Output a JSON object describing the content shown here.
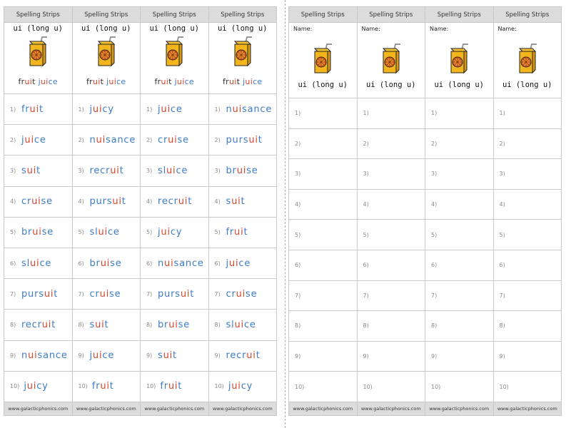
{
  "header_label": "Spelling Strips",
  "footer_label": "www.galacticphonics.com",
  "rule_label": "ui (long u)",
  "caption_parts": [
    {
      "text": "fr",
      "color": ""
    },
    {
      "text": "ui",
      "color": "#d8452b"
    },
    {
      "text": "t ",
      "color": ""
    },
    {
      "text": "j",
      "color": "#3d7cc9"
    },
    {
      "text": "ui",
      "color": "#d8452b"
    },
    {
      "text": "ce",
      "color": "#3d7cc9"
    }
  ],
  "name_label": "Name:",
  "icon": "juice-box-icon",
  "colors": {
    "header_bg": "#dcdcdc",
    "grapheme_red": "#d8452b",
    "word_blue": "#3d7cc9"
  },
  "numbers": [
    "1)",
    "2)",
    "3)",
    "4)",
    "5)",
    "6)",
    "7)",
    "8)",
    "9)",
    "10)"
  ],
  "strips": [
    {
      "words": [
        "fruit",
        "juice",
        "suit",
        "cruise",
        "bruise",
        "sluice",
        "pursuit",
        "recruit",
        "nuisance",
        "juicy"
      ]
    },
    {
      "words": [
        "juicy",
        "nuisance",
        "recruit",
        "pursuit",
        "sluice",
        "bruise",
        "cruise",
        "suit",
        "juice",
        "fruit"
      ]
    },
    {
      "words": [
        "juice",
        "cruise",
        "sluice",
        "recruit",
        "juicy",
        "nuisance",
        "pursuit",
        "bruise",
        "suit",
        "fruit"
      ]
    },
    {
      "words": [
        "nuisance",
        "pursuit",
        "bruise",
        "suit",
        "fruit",
        "juice",
        "cruise",
        "sluice",
        "recruit",
        "juicy"
      ]
    }
  ]
}
